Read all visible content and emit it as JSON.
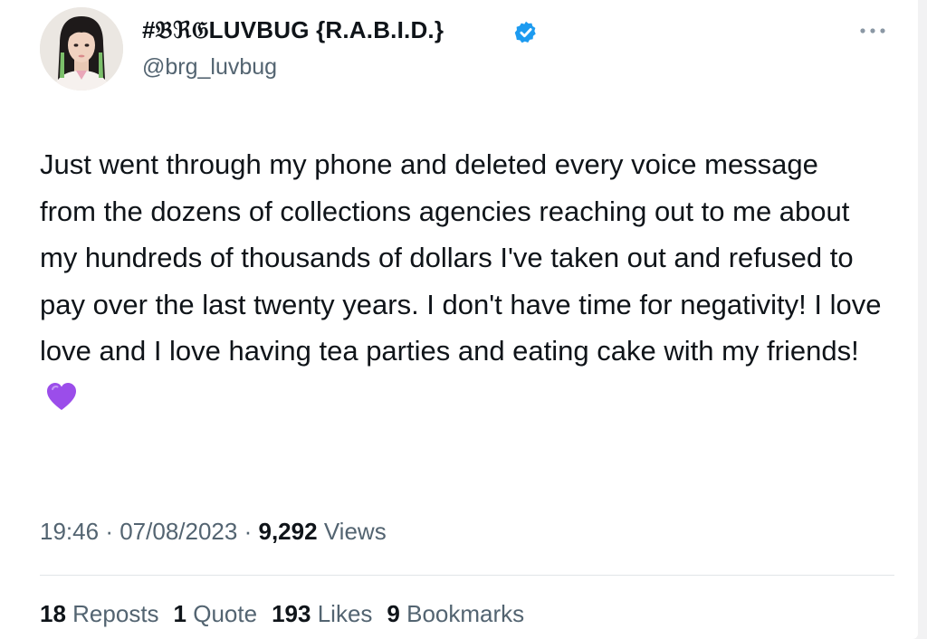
{
  "author": {
    "display_name": "#𝔅ℜ𝔊LUVBUG {R.A.B.I.D.}",
    "handle": "@brg_luvbug",
    "avatar_icon": "user-photo-avatar",
    "verified_icon": "verified-badge-icon",
    "verified_color": "#1d9bf0"
  },
  "more_icon": "more-horizontal-icon",
  "tweet": {
    "text": "Just went through my phone and deleted every voice message from the dozens of collections agencies reaching out to me about my hundreds of thousands of dollars I've taken out and refused to pay over the last twenty years. I don't have time for negativity! I love love and I love having tea parties and eating cake with my friends!",
    "emoji_icon": "purple-heart-icon",
    "emoji_color": "#9b4dea"
  },
  "meta": {
    "time": "19:46",
    "separator": "·",
    "date": "07/08/2023",
    "views_count": "9,292",
    "views_label": "Views"
  },
  "stats": [
    {
      "count": "18",
      "label": "Reposts"
    },
    {
      "count": "1",
      "label": "Quote"
    },
    {
      "count": "193",
      "label": "Likes"
    },
    {
      "count": "9",
      "label": "Bookmarks"
    }
  ]
}
